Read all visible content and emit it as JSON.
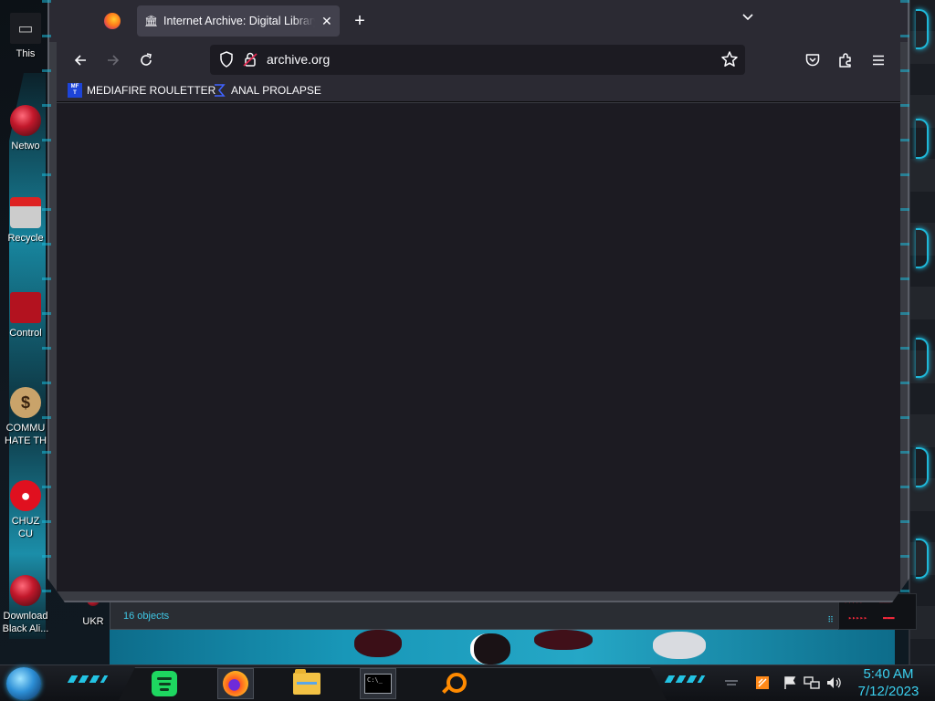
{
  "desktop": {
    "icons": [
      {
        "label": "This"
      },
      {
        "label": "Netwo"
      },
      {
        "label": "Recycle"
      },
      {
        "label": "Control"
      },
      {
        "label": "COMMU\nHATE TH"
      },
      {
        "label": "CHUZ\nCU"
      },
      {
        "label": "Download\nBlack Ali..."
      },
      {
        "label": "UKR"
      }
    ]
  },
  "explorer": {
    "status": "16 objects"
  },
  "browser": {
    "tab": {
      "title": "Internet Archive: Digital Library",
      "favicon": "archive-columns-icon"
    },
    "url": "archive.org",
    "bookmarks": [
      {
        "label": "MEDIAFIRE ROULETTER",
        "favicon_text": "MF\nT"
      },
      {
        "label": "ANAL PROLAPSE",
        "favicon": "ap-sigma-icon"
      }
    ],
    "colors": {
      "chrome": "#2b2a33",
      "urlbar": "#1c1b22",
      "content": "#1c1b22"
    }
  },
  "taskbar": {
    "apps": [
      "spotify",
      "firefox",
      "file-explorer",
      "command-prompt",
      "search-tool"
    ],
    "clock": {
      "time": "5:40 AM",
      "date": "7/12/2023"
    }
  }
}
